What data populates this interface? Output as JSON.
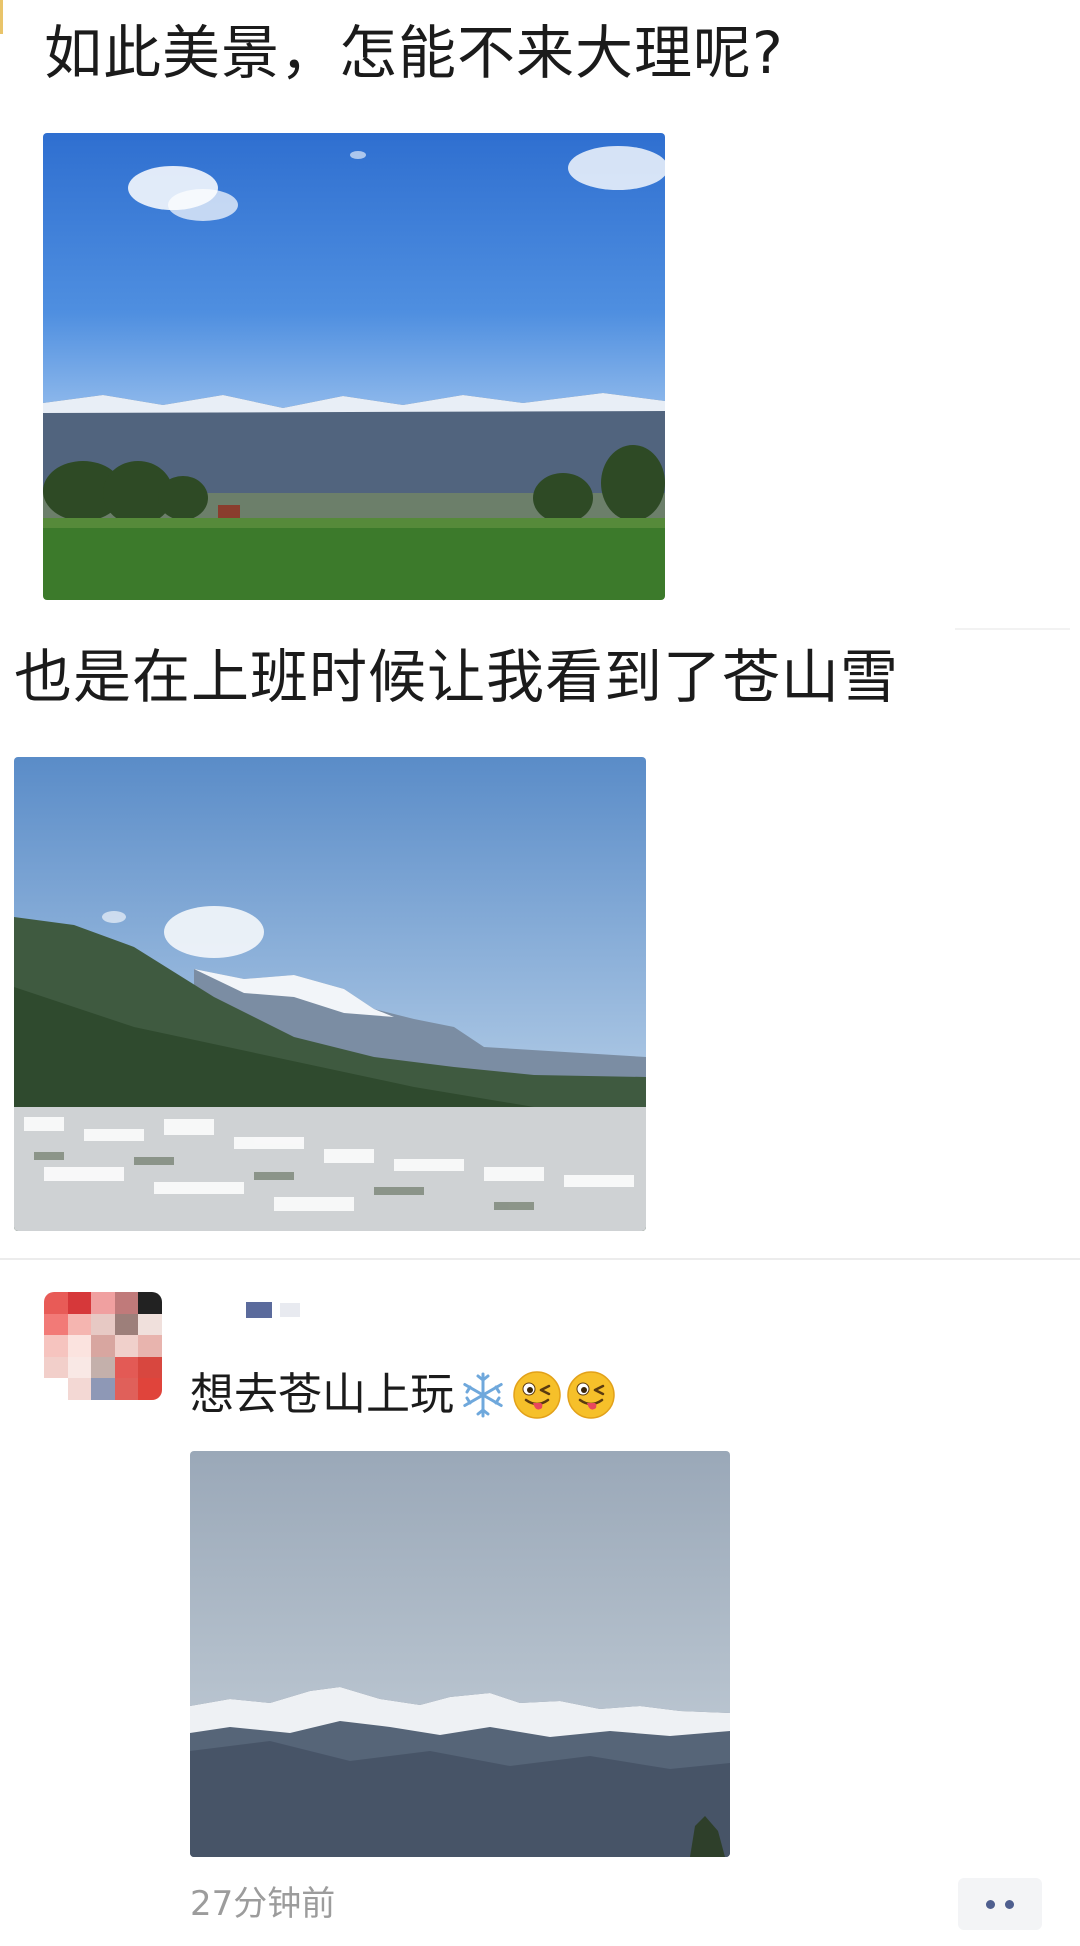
{
  "post": {
    "text_1": "如此美景，怎能不来大理呢?",
    "text_2": "也是在上班时候让我看到了苍山雪"
  },
  "comment": {
    "text": "想去苍山上玩",
    "emojis": [
      "snowflake-emoji",
      "winking-tongue-emoji",
      "winking-tongue-emoji"
    ],
    "timestamp": "27分钟前"
  },
  "colors": {
    "link_blue": "#5b6b9c",
    "timestamp_gray": "#9c9c9c",
    "divider": "#ececec"
  }
}
